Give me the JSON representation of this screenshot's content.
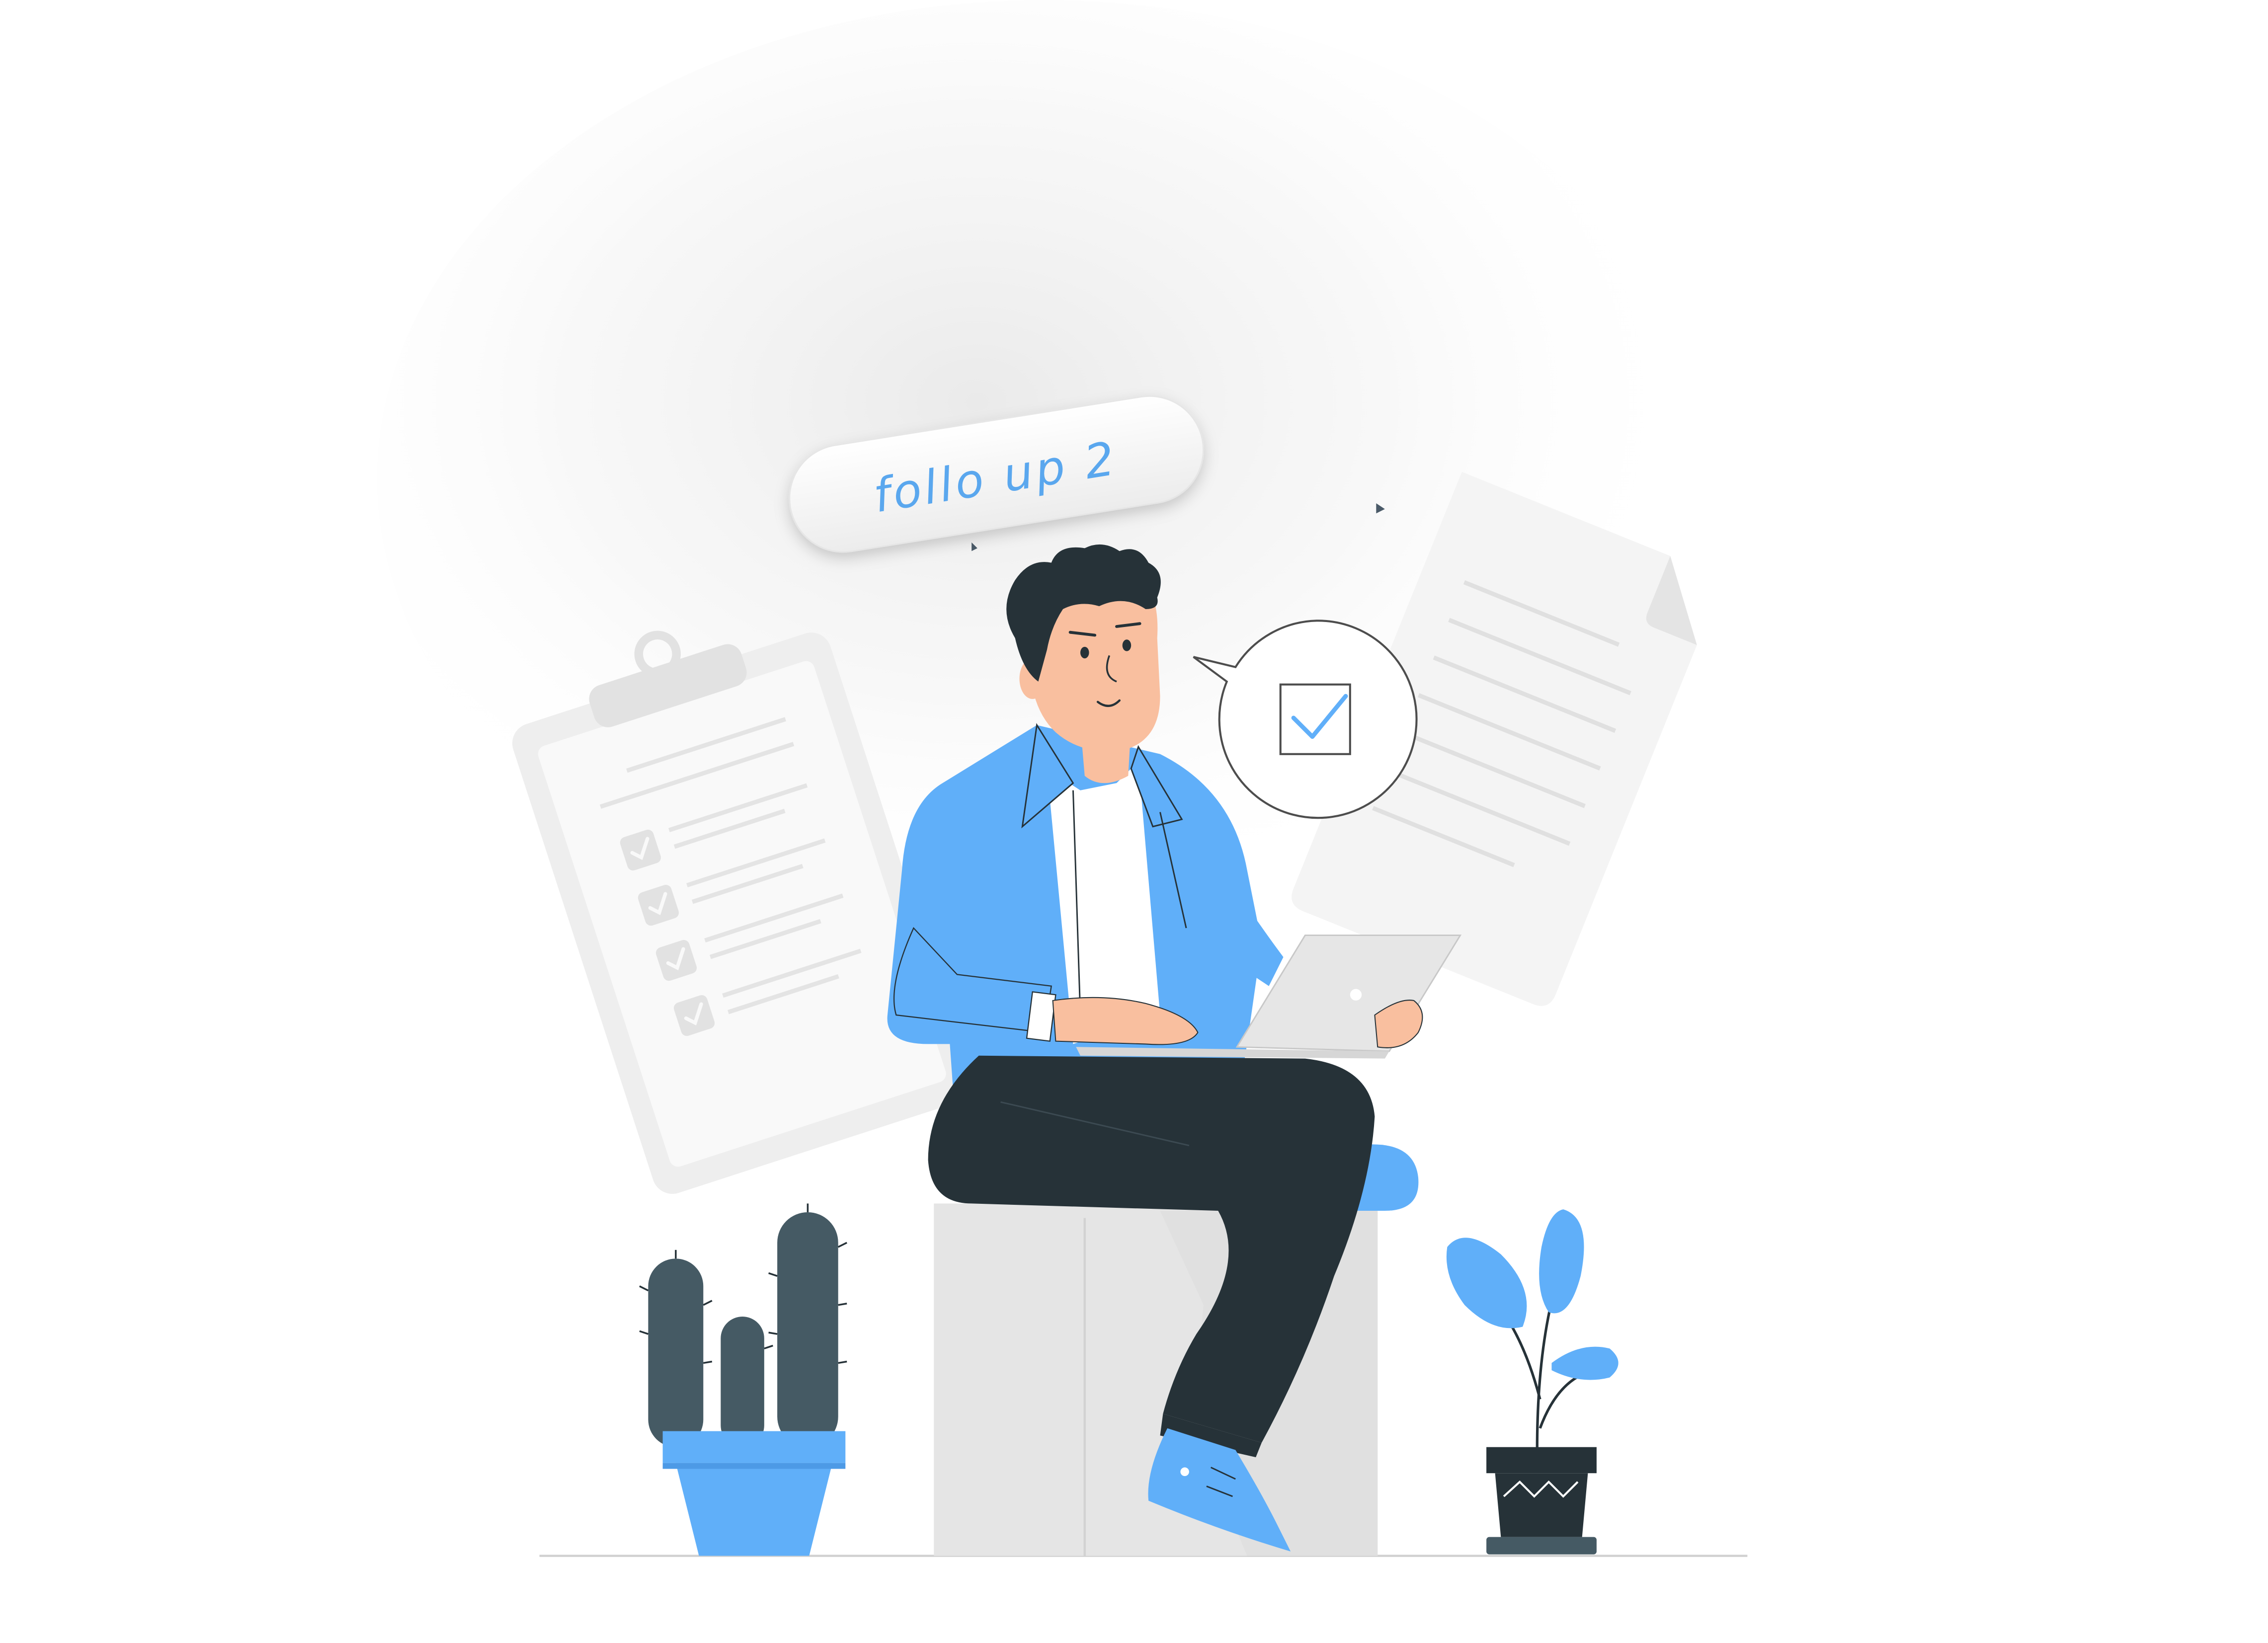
{
  "illustration": {
    "label_pill": {
      "text": "follo up 2"
    },
    "colors": {
      "accent_blue": "#60aff9",
      "dark_navy": "#263238",
      "skin": "#f9bf9f",
      "light_gray": "#e5e5e5",
      "paper_gray": "#f3f3f3",
      "background": "#ffffff"
    },
    "icons": [
      "clipboard-checklist",
      "document-page",
      "speech-bubble-check",
      "laptop",
      "cactus-pot",
      "leaf-plant-pot",
      "person-sitting"
    ]
  }
}
